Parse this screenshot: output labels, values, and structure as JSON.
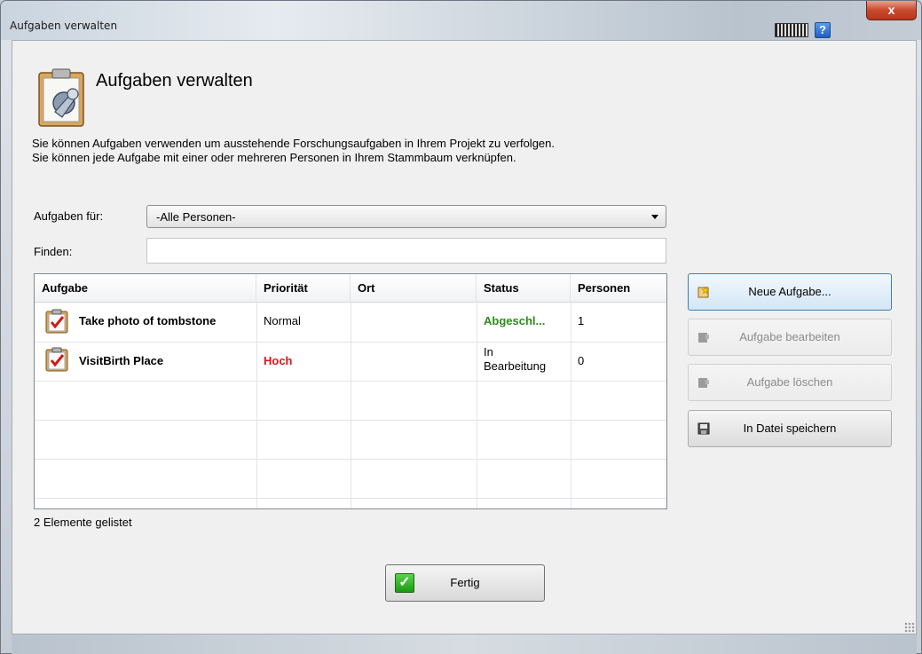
{
  "window": {
    "title": "Aufgaben verwalten",
    "help_label": "?",
    "close_label": "x"
  },
  "header": {
    "title": "Aufgaben verwalten",
    "description_line1": "Sie können Aufgaben verwenden um ausstehende Forschungsaufgaben in Ihrem Projekt zu verfolgen.",
    "description_line2": "Sie können jede Aufgabe mit einer oder mehreren Personen in Ihrem Stammbaum verknüpfen."
  },
  "filter": {
    "label": "Aufgaben für:",
    "selected": "-Alle Personen-"
  },
  "search": {
    "label": "Finden:",
    "value": ""
  },
  "table": {
    "columns": [
      "Aufgabe",
      "Priorität",
      "Ort",
      "Status",
      "Personen"
    ],
    "rows": [
      {
        "task": "Take photo of tombstone",
        "priority": "Normal",
        "place": "",
        "status": "Abgeschl...",
        "persons": "1"
      },
      {
        "task": "VisitBirth Place",
        "priority": "Hoch",
        "place": "",
        "status_line1": "In",
        "status_line2": "Bearbeitung",
        "persons": "0"
      }
    ],
    "count_label": "2 Elemente gelistet"
  },
  "buttons": {
    "new_task": "Neue Aufgabe...",
    "edit_task": "Aufgabe bearbeiten",
    "delete_task": "Aufgabe löschen",
    "save_to_file": "In Datei speichern",
    "done": "Fertig",
    "done_icon_glyph": "✓"
  },
  "colors": {
    "priority_high": "#e0141a",
    "status_done": "#2e8b1a",
    "primary_button_border": "#3c7fb1"
  }
}
